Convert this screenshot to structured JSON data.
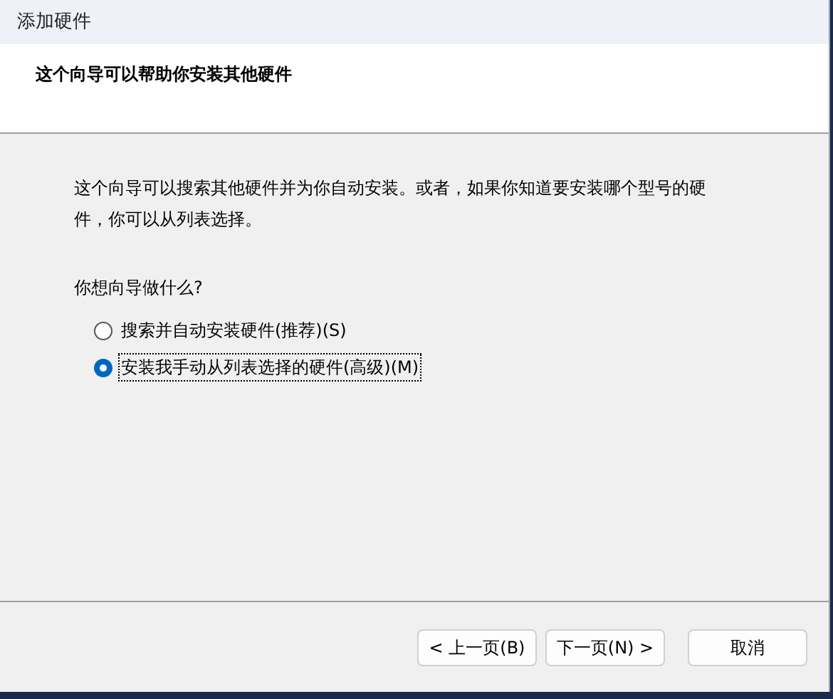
{
  "window": {
    "title": "添加硬件"
  },
  "header": {
    "title": "这个向导可以帮助你安装其他硬件"
  },
  "description": "这个向导可以搜索其他硬件并为你自动安装。或者，如果你知道要安装哪个型号的硬件，你可以从列表选择。",
  "question": "你想向导做什么?",
  "options": [
    {
      "label": "搜索并自动安装硬件(推荐)(S)",
      "selected": false
    },
    {
      "label": "安装我手动从列表选择的硬件(高级)(M)",
      "selected": true
    }
  ],
  "buttons": [
    {
      "label": "< 上一页(B)"
    },
    {
      "label": "下一页(N) >"
    },
    {
      "label": "取消"
    }
  ]
}
